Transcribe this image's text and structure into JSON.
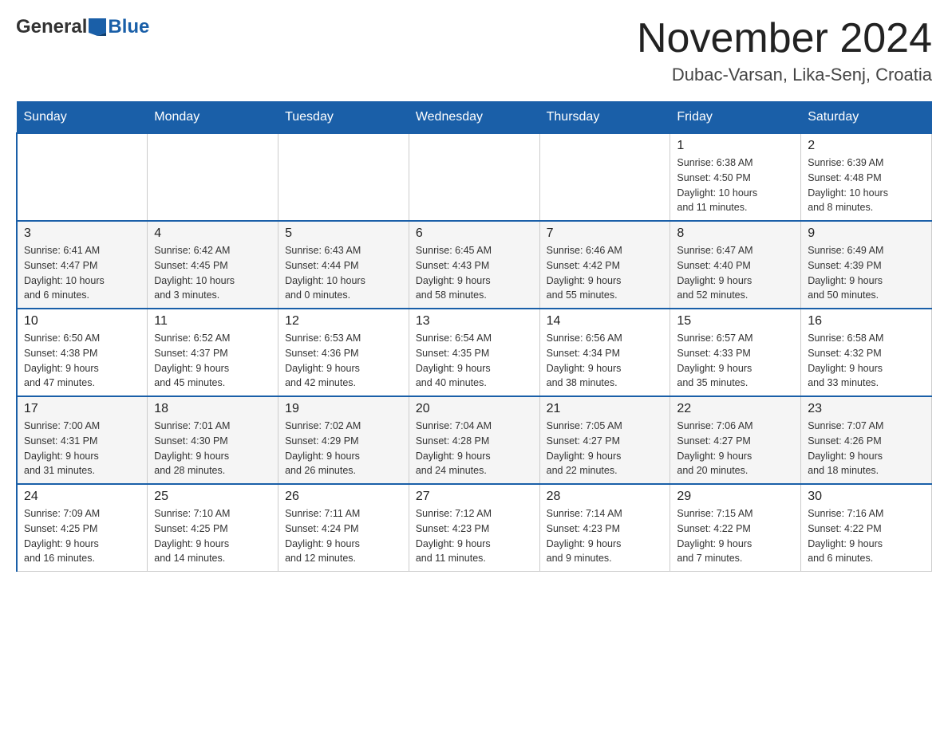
{
  "header": {
    "logo_general": "General",
    "logo_blue": "Blue",
    "month_title": "November 2024",
    "location": "Dubac-Varsan, Lika-Senj, Croatia"
  },
  "days_of_week": [
    "Sunday",
    "Monday",
    "Tuesday",
    "Wednesday",
    "Thursday",
    "Friday",
    "Saturday"
  ],
  "weeks": [
    [
      {
        "day": "",
        "info": ""
      },
      {
        "day": "",
        "info": ""
      },
      {
        "day": "",
        "info": ""
      },
      {
        "day": "",
        "info": ""
      },
      {
        "day": "",
        "info": ""
      },
      {
        "day": "1",
        "info": "Sunrise: 6:38 AM\nSunset: 4:50 PM\nDaylight: 10 hours\nand 11 minutes."
      },
      {
        "day": "2",
        "info": "Sunrise: 6:39 AM\nSunset: 4:48 PM\nDaylight: 10 hours\nand 8 minutes."
      }
    ],
    [
      {
        "day": "3",
        "info": "Sunrise: 6:41 AM\nSunset: 4:47 PM\nDaylight: 10 hours\nand 6 minutes."
      },
      {
        "day": "4",
        "info": "Sunrise: 6:42 AM\nSunset: 4:45 PM\nDaylight: 10 hours\nand 3 minutes."
      },
      {
        "day": "5",
        "info": "Sunrise: 6:43 AM\nSunset: 4:44 PM\nDaylight: 10 hours\nand 0 minutes."
      },
      {
        "day": "6",
        "info": "Sunrise: 6:45 AM\nSunset: 4:43 PM\nDaylight: 9 hours\nand 58 minutes."
      },
      {
        "day": "7",
        "info": "Sunrise: 6:46 AM\nSunset: 4:42 PM\nDaylight: 9 hours\nand 55 minutes."
      },
      {
        "day": "8",
        "info": "Sunrise: 6:47 AM\nSunset: 4:40 PM\nDaylight: 9 hours\nand 52 minutes."
      },
      {
        "day": "9",
        "info": "Sunrise: 6:49 AM\nSunset: 4:39 PM\nDaylight: 9 hours\nand 50 minutes."
      }
    ],
    [
      {
        "day": "10",
        "info": "Sunrise: 6:50 AM\nSunset: 4:38 PM\nDaylight: 9 hours\nand 47 minutes."
      },
      {
        "day": "11",
        "info": "Sunrise: 6:52 AM\nSunset: 4:37 PM\nDaylight: 9 hours\nand 45 minutes."
      },
      {
        "day": "12",
        "info": "Sunrise: 6:53 AM\nSunset: 4:36 PM\nDaylight: 9 hours\nand 42 minutes."
      },
      {
        "day": "13",
        "info": "Sunrise: 6:54 AM\nSunset: 4:35 PM\nDaylight: 9 hours\nand 40 minutes."
      },
      {
        "day": "14",
        "info": "Sunrise: 6:56 AM\nSunset: 4:34 PM\nDaylight: 9 hours\nand 38 minutes."
      },
      {
        "day": "15",
        "info": "Sunrise: 6:57 AM\nSunset: 4:33 PM\nDaylight: 9 hours\nand 35 minutes."
      },
      {
        "day": "16",
        "info": "Sunrise: 6:58 AM\nSunset: 4:32 PM\nDaylight: 9 hours\nand 33 minutes."
      }
    ],
    [
      {
        "day": "17",
        "info": "Sunrise: 7:00 AM\nSunset: 4:31 PM\nDaylight: 9 hours\nand 31 minutes."
      },
      {
        "day": "18",
        "info": "Sunrise: 7:01 AM\nSunset: 4:30 PM\nDaylight: 9 hours\nand 28 minutes."
      },
      {
        "day": "19",
        "info": "Sunrise: 7:02 AM\nSunset: 4:29 PM\nDaylight: 9 hours\nand 26 minutes."
      },
      {
        "day": "20",
        "info": "Sunrise: 7:04 AM\nSunset: 4:28 PM\nDaylight: 9 hours\nand 24 minutes."
      },
      {
        "day": "21",
        "info": "Sunrise: 7:05 AM\nSunset: 4:27 PM\nDaylight: 9 hours\nand 22 minutes."
      },
      {
        "day": "22",
        "info": "Sunrise: 7:06 AM\nSunset: 4:27 PM\nDaylight: 9 hours\nand 20 minutes."
      },
      {
        "day": "23",
        "info": "Sunrise: 7:07 AM\nSunset: 4:26 PM\nDaylight: 9 hours\nand 18 minutes."
      }
    ],
    [
      {
        "day": "24",
        "info": "Sunrise: 7:09 AM\nSunset: 4:25 PM\nDaylight: 9 hours\nand 16 minutes."
      },
      {
        "day": "25",
        "info": "Sunrise: 7:10 AM\nSunset: 4:25 PM\nDaylight: 9 hours\nand 14 minutes."
      },
      {
        "day": "26",
        "info": "Sunrise: 7:11 AM\nSunset: 4:24 PM\nDaylight: 9 hours\nand 12 minutes."
      },
      {
        "day": "27",
        "info": "Sunrise: 7:12 AM\nSunset: 4:23 PM\nDaylight: 9 hours\nand 11 minutes."
      },
      {
        "day": "28",
        "info": "Sunrise: 7:14 AM\nSunset: 4:23 PM\nDaylight: 9 hours\nand 9 minutes."
      },
      {
        "day": "29",
        "info": "Sunrise: 7:15 AM\nSunset: 4:22 PM\nDaylight: 9 hours\nand 7 minutes."
      },
      {
        "day": "30",
        "info": "Sunrise: 7:16 AM\nSunset: 4:22 PM\nDaylight: 9 hours\nand 6 minutes."
      }
    ]
  ]
}
